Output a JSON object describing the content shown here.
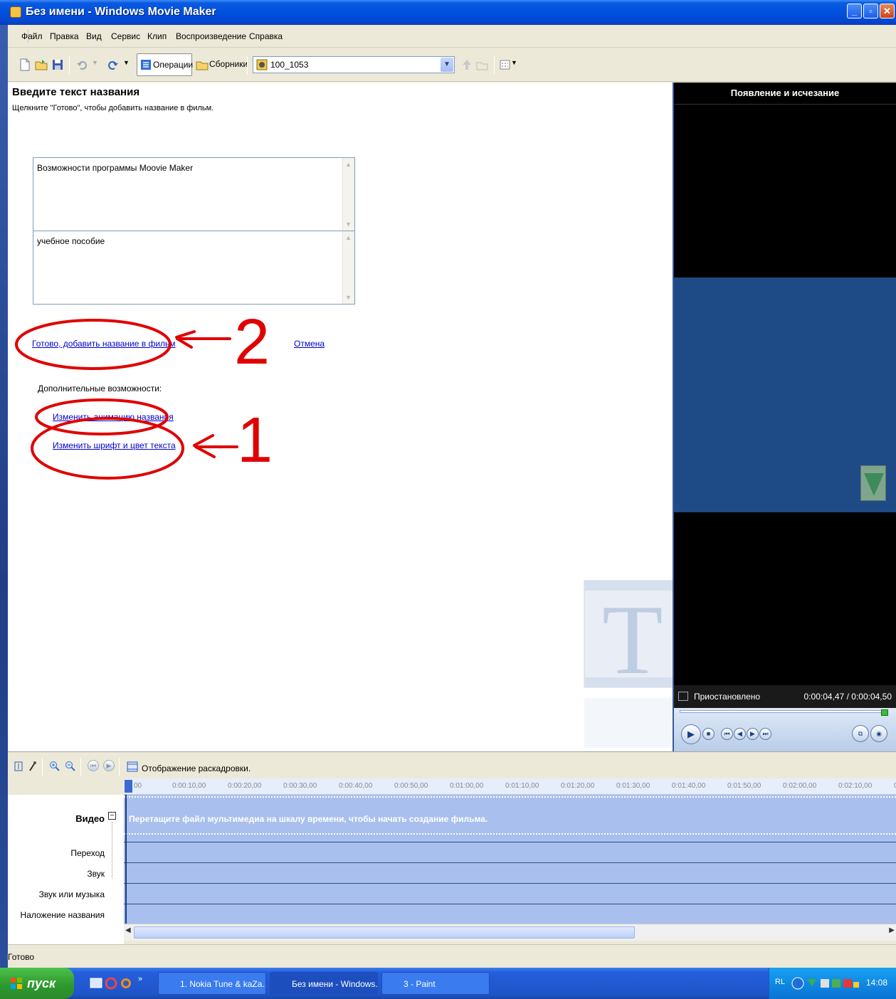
{
  "window": {
    "title": "Без имени - Windows Movie Maker"
  },
  "menu": [
    "Файл",
    "Правка",
    "Вид",
    "Сервис",
    "Клип",
    "Воспроизведение",
    "Справка"
  ],
  "toolbar": {
    "operations_label": "Операции",
    "collections_label": "Сборники",
    "collection_value": "100_1053"
  },
  "task": {
    "title": "Введите текст названия",
    "subtitle": "Щелкните \"Готово\", чтобы добавить название в фильм.",
    "title_text": "Возможности программы Moovie Maker",
    "subtitle_text": "учебное пособие",
    "done_link": "Готово, добавить название в фильм",
    "cancel_link": "Отмена",
    "more_options_label": "Дополнительные возможности:",
    "change_animation_link": "Изменить анимацию названия",
    "change_font_link": "Изменить шрифт и цвет текста"
  },
  "annotations": {
    "label_1": "1",
    "label_2": "2",
    "ink_color": "#e00000"
  },
  "preview": {
    "title": "Появление и исчезание",
    "status": "Приостановлено",
    "time": "0:00:04,47 / 0:00:04,50",
    "seek_fraction": 0.993
  },
  "timeline": {
    "toggle_label": "Отображение раскадровки.",
    "ticks": [
      "00",
      "0:00:10,00",
      "0:00:20,00",
      "0:00:30,00",
      "0:00:40,00",
      "0:00:50,00",
      "0:01:00,00",
      "0:01:10,00",
      "0:01:20,00",
      "0:01:30,00",
      "0:01:40,00",
      "0:01:50,00",
      "0:02:00,00",
      "0:02:10,00",
      "0:0"
    ],
    "tracks": {
      "video": "Видео",
      "transition": "Переход",
      "audio": "Звук",
      "music": "Звук или музыка",
      "title_overlay": "Наложение названия"
    },
    "video_hint": "Перетащите файл мультимедиа на шкалу времени, чтобы начать создание фильма."
  },
  "statusbar": {
    "text": "Готово"
  },
  "taskbar": {
    "start_label": "пуск",
    "buttons": [
      "1. Nokia Tune & kaZa...",
      "Без имени - Windows...",
      "3 - Paint"
    ],
    "lang": "RL",
    "clock": "14:08"
  },
  "colors": {
    "titlebar": "#0050de",
    "preview_frame": "#1e4a86",
    "timeline_track": "#a9c0ee",
    "link": "#0000cc"
  }
}
